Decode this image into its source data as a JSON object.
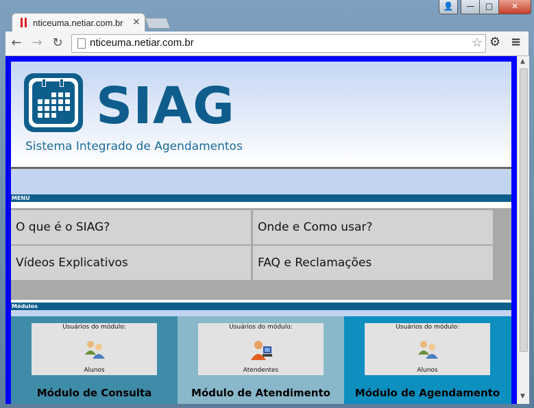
{
  "browser": {
    "tab_title": "nticeuma.netiar.com.br",
    "tab_close": "×",
    "url": "nticeuma.netiar.com.br",
    "back_icon": "←",
    "forward_icon": "→",
    "reload_icon": "↻",
    "star_icon": "☆",
    "settings_icon": "⚙",
    "menu_icon": "≡",
    "window_controls": {
      "user": "👤",
      "minimize": "—",
      "maximize": "□",
      "close": "✕"
    }
  },
  "site": {
    "brand": "SIAG",
    "brand_subtitle": "Sistema Integrado de Agendamentos",
    "menu_label": "MENU",
    "menu_items": [
      "O que é o SIAG?",
      "Onde e Como usar?",
      "Vídeos Explicativos",
      "FAQ e Reclamações"
    ],
    "modules_label": "Módulos",
    "modules": [
      {
        "users_caption": "Usuários do módulo:",
        "role": "Alunos",
        "title": "Módulo de Consulta",
        "bg": "#3f8ca8"
      },
      {
        "users_caption": "Usuários do módulo:",
        "role": "Atendentes",
        "title": "Módulo de Atendimento",
        "bg": "#88b8c9"
      },
      {
        "users_caption": "Usuários do módulo:",
        "role": "Alunos",
        "title": "Módulo de Agendamento",
        "bg": "#0d8fbf"
      }
    ]
  },
  "colors": {
    "frame": "#0000ff",
    "brand_blue": "#0f5d8c",
    "menu_bg": "#d3d3d3"
  }
}
